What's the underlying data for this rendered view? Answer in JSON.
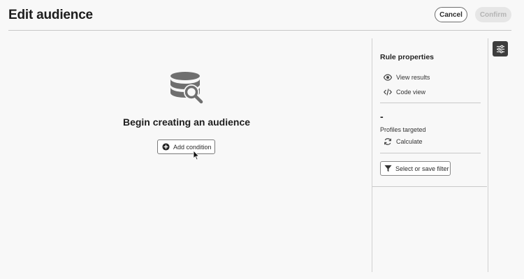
{
  "header": {
    "title": "Edit audience",
    "cancel_label": "Cancel",
    "confirm_label": "Confirm"
  },
  "canvas": {
    "empty_icon": "database-search-icon",
    "empty_title": "Begin creating an audience",
    "add_condition_label": "Add condition",
    "add_condition_icon": "plus-circle-icon"
  },
  "rule_panel": {
    "title": "Rule properties",
    "view_results_label": "View results",
    "view_results_icon": "eye-icon",
    "code_view_label": "Code view",
    "code_view_icon": "code-icon",
    "profiles_value": "-",
    "profiles_label": "Profiles targeted",
    "calculate_label": "Calculate",
    "calculate_icon": "refresh-icon",
    "filter_label": "Select or save filter",
    "filter_icon": "filter-icon"
  },
  "side_toggle": {
    "icon": "properties-sliders-icon"
  },
  "colors": {
    "background": "#f8f8f8",
    "dark_button": "#3d3d3d",
    "disabled_button": "#e6e6e6",
    "disabled_text": "#b4b4b4"
  }
}
